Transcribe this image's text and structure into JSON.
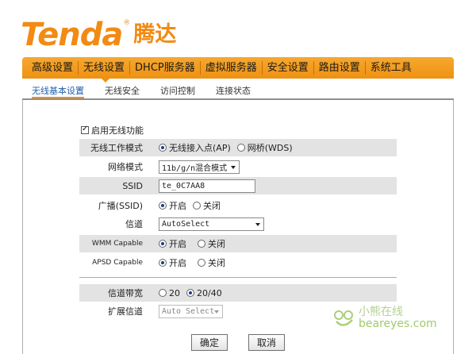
{
  "brand": {
    "name_en": "Tenda",
    "reg_mark": "®",
    "name_cn": "腾达"
  },
  "nav": {
    "items": [
      {
        "label": "高级设置"
      },
      {
        "label": "无线设置"
      },
      {
        "label": "DHCP服务器"
      },
      {
        "label": "虚拟服务器"
      },
      {
        "label": "安全设置"
      },
      {
        "label": "路由设置"
      },
      {
        "label": "系统工具"
      }
    ],
    "active": "无线设置"
  },
  "subnav": {
    "items": [
      {
        "label": "无线基本设置"
      },
      {
        "label": "无线安全"
      },
      {
        "label": "访问控制"
      },
      {
        "label": "连接状态"
      }
    ],
    "active": "无线基本设置"
  },
  "form": {
    "enable_wireless": {
      "label": "启用无线功能",
      "checked": true
    },
    "mode": {
      "label": "无线工作模式",
      "options": [
        "无线接入点(AP)",
        "网桥(WDS)"
      ],
      "selected": "无线接入点(AP)"
    },
    "network_mode": {
      "label": "网络模式",
      "value": "11b/g/n混合模式"
    },
    "ssid": {
      "label": "SSID",
      "value": "te_0C7AA8"
    },
    "broadcast": {
      "label": "广播(SSID)",
      "options": [
        "开启",
        "关闭"
      ],
      "selected": "开启"
    },
    "channel": {
      "label": "信道",
      "value": "AutoSelect"
    },
    "wmm": {
      "label": "WMM Capable",
      "options": [
        "开启",
        "关闭"
      ],
      "selected": "开启"
    },
    "apsd": {
      "label": "APSD Capable",
      "options": [
        "开启",
        "关闭"
      ],
      "selected": "开启"
    },
    "bandwidth": {
      "label": "信道带宽",
      "options": [
        "20",
        "20/40"
      ],
      "selected": "20/40"
    },
    "ext_channel": {
      "label": "扩展信道",
      "value": "Auto Select"
    }
  },
  "buttons": {
    "ok": "确定",
    "cancel": "取消"
  },
  "watermark": {
    "cn": "小熊在线",
    "en": "beareyes.com"
  },
  "colors": {
    "accent": "#ee9112",
    "brand": "#f28a13",
    "link": "#1f5fad",
    "row_shade": "#e3e3e3"
  }
}
